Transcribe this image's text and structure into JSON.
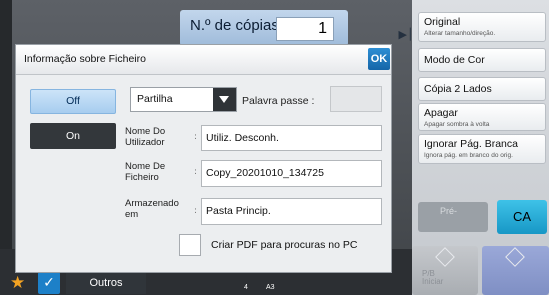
{
  "header": {
    "copies_label": "N.º de cópias",
    "copies_value": "1"
  },
  "right_menu": {
    "items": [
      {
        "title": "Original",
        "subtitle": "Alterar tamanho/direção."
      },
      {
        "title": "Modo de Cor",
        "subtitle": ""
      },
      {
        "title": "Cópia 2 Lados",
        "subtitle": ""
      },
      {
        "title": "Apagar",
        "subtitle": "Apagar sombra à volta"
      },
      {
        "title": "Ignorar Pág. Branca",
        "subtitle": "Ignora pág. em branco do orig."
      }
    ],
    "preview_label": "Pré-",
    "ca_label": "CA",
    "start_bw_label_1": "P/B",
    "start_bw_label_2": "Iniciar"
  },
  "bottom_bar": {
    "others_label": "Outros",
    "page_count": "4",
    "paper_size": "A3"
  },
  "dialog": {
    "title": "Informação sobre Ficheiro",
    "ok_label": "OK",
    "off_label": "Off",
    "on_label": "On",
    "sharing_value": "Partilha",
    "password_label": "Palavra passe :",
    "password_value": "",
    "fields": [
      {
        "label": "Nome Do Utilizador",
        "value": "Utiliz. Desconh."
      },
      {
        "label": "Nome De Ficheiro",
        "value": "Copy_20201010_134725"
      },
      {
        "label": "Armazenado em",
        "value": "Pasta Princip."
      }
    ],
    "pdf_label": "Criar PDF para procuras no PC",
    "pdf_checked": false
  },
  "colors": {
    "accent_blue": "#1565a8",
    "ca_cyan": "#1797c6",
    "selected_toggle": "#a7cdef"
  }
}
